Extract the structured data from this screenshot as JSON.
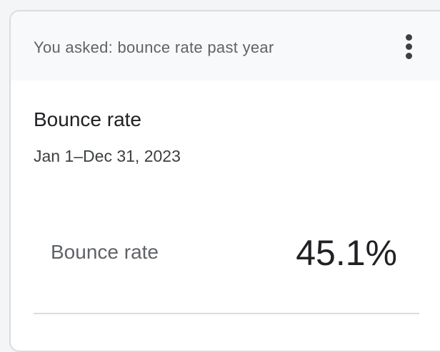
{
  "header": {
    "query_text": "You asked: bounce rate past year",
    "menu_icon": "more-vert-icon"
  },
  "card": {
    "title": "Bounce rate",
    "date_range": "Jan 1–Dec 31, 2023"
  },
  "metric": {
    "label": "Bounce rate",
    "value": "45.1%"
  },
  "colors": {
    "header_background": "#f8f9fa",
    "border": "#dadce0",
    "primary_text": "#202124",
    "secondary_text": "#5f6368"
  }
}
